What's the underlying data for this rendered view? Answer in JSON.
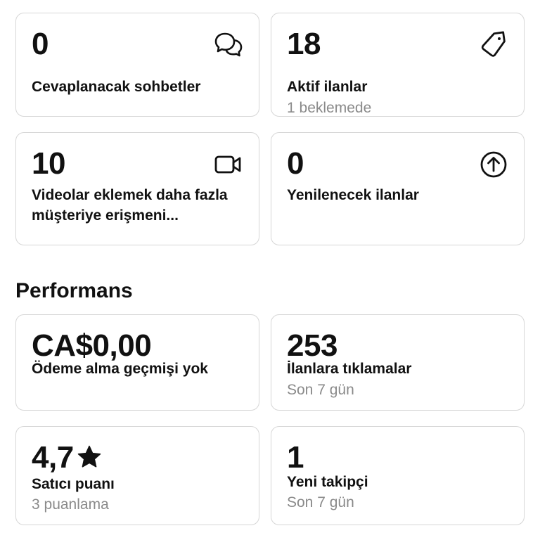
{
  "cards_top": [
    {
      "value": "0",
      "label": "Cevaplanacak sohbetler",
      "icon": "chat-bubbles-icon"
    },
    {
      "value": "18",
      "label": "Aktif ilanlar",
      "sub": "1 beklemede",
      "icon": "price-tag-icon"
    },
    {
      "value": "10",
      "label": "Videolar eklemek daha fazla müşteriye erişmeni...",
      "icon": "video-camera-icon"
    },
    {
      "value": "0",
      "label": "Yenilenecek ilanlar",
      "icon": "arrow-up-circle-icon"
    }
  ],
  "performance": {
    "title": "Performans",
    "cards": [
      {
        "value": "CA$0,00",
        "label": "Ödeme alma geçmişi yok"
      },
      {
        "value": "253",
        "label": "İlanlara tıklamalar",
        "sub": "Son 7 gün"
      },
      {
        "value": "4,7",
        "label": "Satıcı puanı",
        "sub": "3 puanlama",
        "icon": "star-icon"
      },
      {
        "value": "1",
        "label": "Yeni takipçi",
        "sub": "Son 7 gün"
      }
    ]
  }
}
